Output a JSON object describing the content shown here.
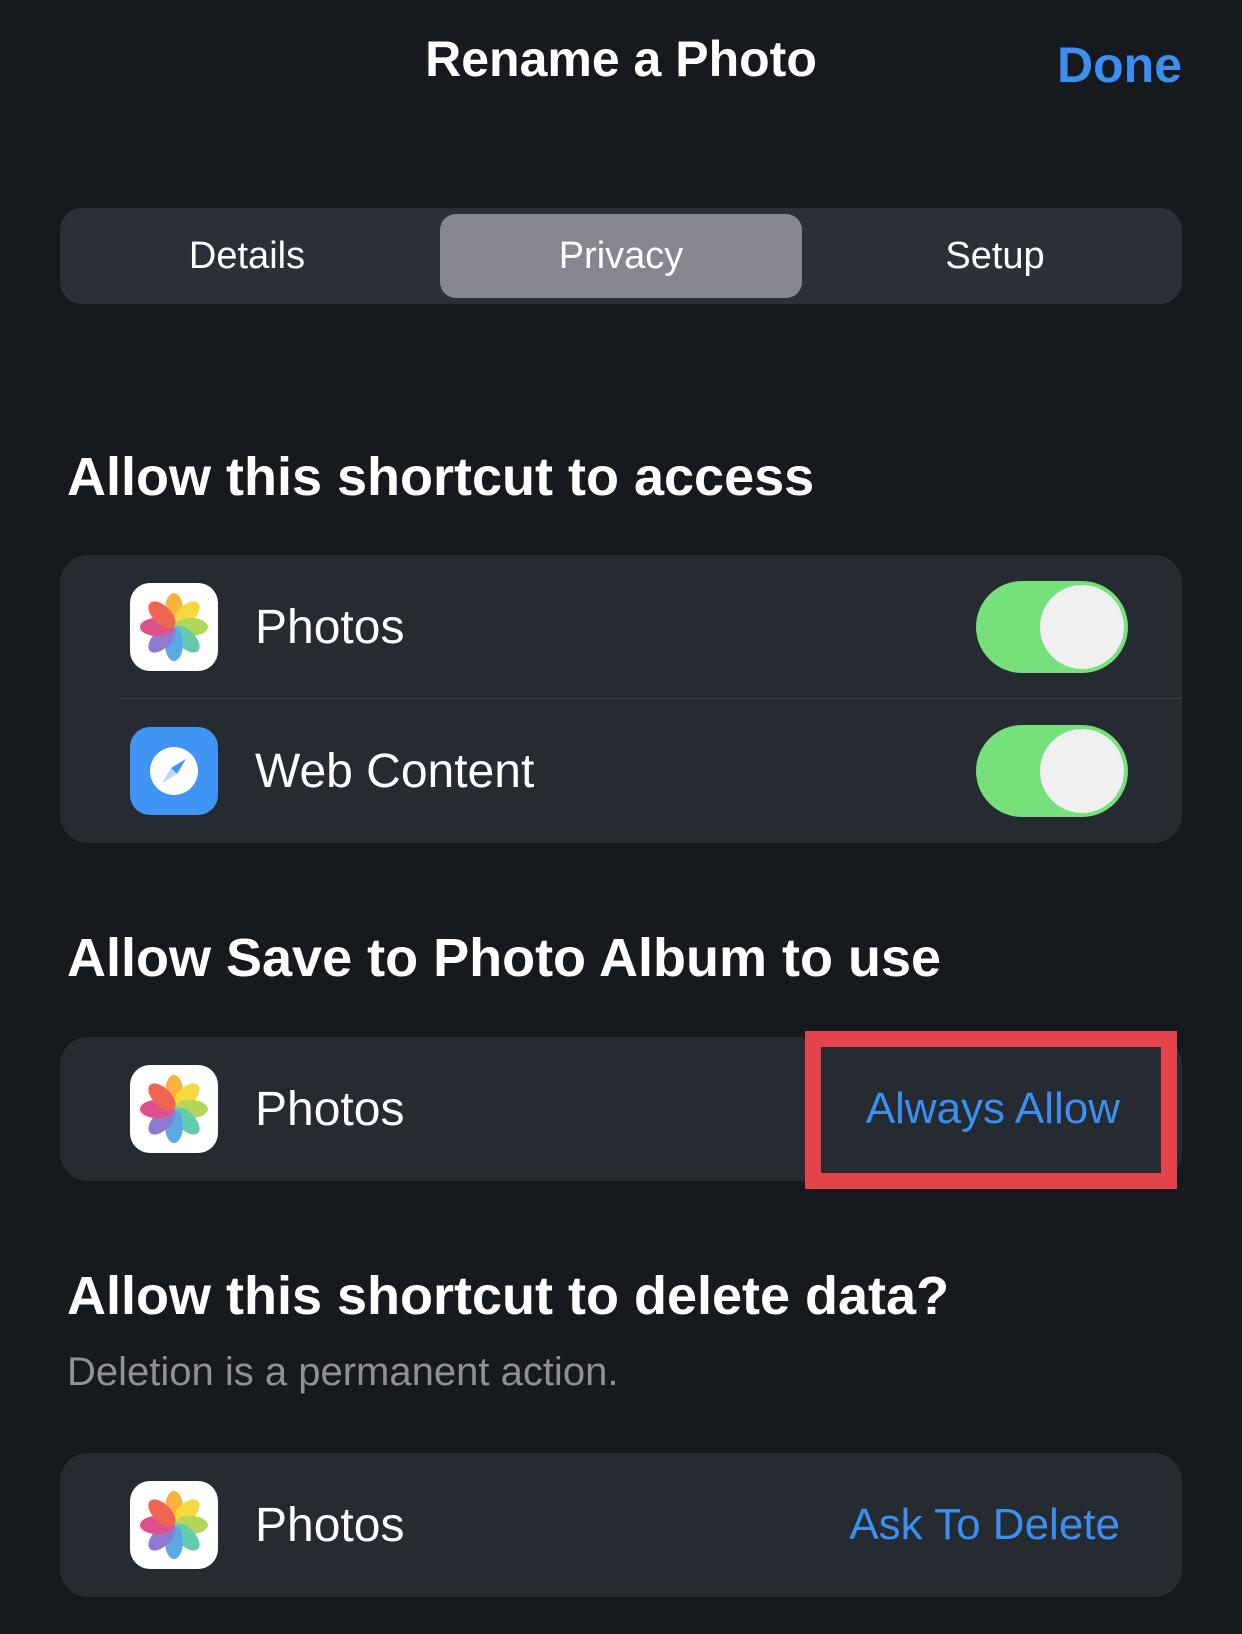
{
  "nav": {
    "title": "Rename a Photo",
    "done_label": "Done"
  },
  "tabs": [
    {
      "label": "Details",
      "selected": false
    },
    {
      "label": "Privacy",
      "selected": true
    },
    {
      "label": "Setup",
      "selected": false
    }
  ],
  "access_section": {
    "title": "Allow this shortcut to access",
    "items": [
      {
        "label": "Photos",
        "icon": "photos-app-icon",
        "enabled": true
      },
      {
        "label": "Web Content",
        "icon": "safari-compass-icon",
        "enabled": true
      }
    ]
  },
  "save_section": {
    "title": "Allow Save to Photo Album to use",
    "items": [
      {
        "label": "Photos",
        "icon": "photos-app-icon",
        "action": "Always Allow"
      }
    ]
  },
  "delete_section": {
    "title": "Allow this shortcut to delete data?",
    "subtitle": "Deletion is a permanent action.",
    "items": [
      {
        "label": "Photos",
        "icon": "photos-app-icon",
        "action": "Ask To Delete"
      }
    ]
  },
  "colors": {
    "background": "#16191e",
    "group": "#262a31",
    "accent": "#3b8ff0",
    "toggle_on": "#76e07a",
    "highlight": "#e5434c"
  }
}
